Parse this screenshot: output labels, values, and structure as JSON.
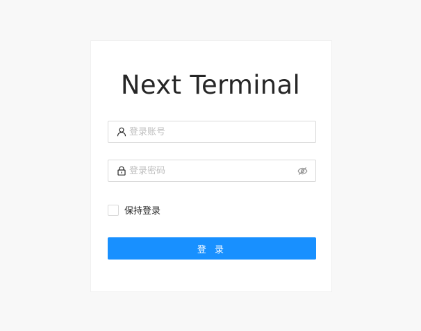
{
  "app": {
    "title": "Next Terminal"
  },
  "form": {
    "username": {
      "placeholder": "登录账号",
      "value": "",
      "icon": "user-icon"
    },
    "password": {
      "placeholder": "登录密码",
      "value": "",
      "icon": "lock-icon",
      "toggle_icon": "eye-invisible-icon"
    },
    "remember": {
      "label": "保持登录",
      "checked": false
    },
    "submit_label": "登 录"
  },
  "colors": {
    "primary": "#1890ff",
    "page_background": "#f8f8f8",
    "card_background": "#ffffff",
    "border": "#d9d9d9",
    "placeholder": "#bfbfbf"
  }
}
